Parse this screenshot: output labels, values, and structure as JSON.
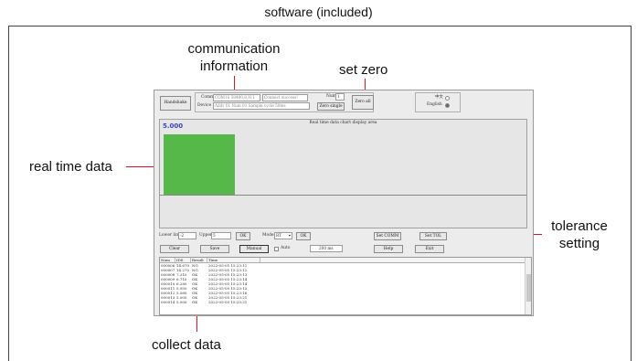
{
  "page_title": "software (included)",
  "callouts": {
    "communication": [
      "communication",
      "information"
    ],
    "set_zero": "set zero",
    "real_time": "real time data",
    "tolerance": [
      "tolerance",
      "setting"
    ],
    "collect": "collect data"
  },
  "colors": {
    "callout_line": "#d8181f",
    "bar": "#56b848",
    "value_text": "#3a45b8"
  },
  "app": {
    "top": {
      "handshake_btn": "Handshake",
      "comm_label": "Comm",
      "comm_value": "COM16 38400,8,N,1",
      "comm_status": "Connect success!",
      "device_label": "Device",
      "device_value": "Addr 01  Num 01  Sample cycle 50ms",
      "num_label": "Num",
      "num_value": "1",
      "zero_single_btn": "Zero single",
      "zero_all_btn": "Zero all",
      "lang_cn": "中文",
      "lang_en": "English"
    },
    "chart": {
      "title": "Real time data chart display area",
      "current_value": "5.000",
      "bar_fraction": 0.8
    },
    "controls": {
      "lower_label": "Lower limit",
      "lower_value": "-2",
      "upper_label": "Upper",
      "upper_value": "5",
      "ok1": "OK",
      "mode_label": "Mode",
      "mode_value": "RT",
      "ok2": "OK",
      "set_comm": "Set COMM",
      "set_tol": "Set TOL"
    },
    "actions": {
      "clear": "Clear",
      "save": "Save",
      "manual": "Manual",
      "auto": "Auto",
      "interval": "200",
      "interval_unit": "ms",
      "help": "Help",
      "exit": "Exit"
    },
    "table": {
      "headers": [
        "Num",
        "IDS",
        "Result",
        "Time",
        ""
      ],
      "rows": [
        [
          "000006",
          "14.670",
          "NG",
          "2022-05-05  15:23:11"
        ],
        [
          "000007",
          "14.270",
          "NG",
          "2022-05-05  15:23:12"
        ],
        [
          "000008",
          "7.310",
          "OK",
          "2022-05-05  15:23:13"
        ],
        [
          "000009",
          "6.710",
          "OK",
          "2022-05-05  15:23:14"
        ],
        [
          "000010",
          "6.280",
          "OK",
          "2022-05-05  15:23:14"
        ],
        [
          "000011",
          "5.950",
          "OK",
          "2022-05-05  15:23:15"
        ],
        [
          "000012",
          "5.560",
          "OK",
          "2022-05-05  15:23:16"
        ],
        [
          "000013",
          "5.000",
          "OK",
          "2022-05-05  15:23:21"
        ],
        [
          "000014",
          "5.000",
          "OK",
          "2022-05-05  15:23:21"
        ]
      ]
    }
  }
}
